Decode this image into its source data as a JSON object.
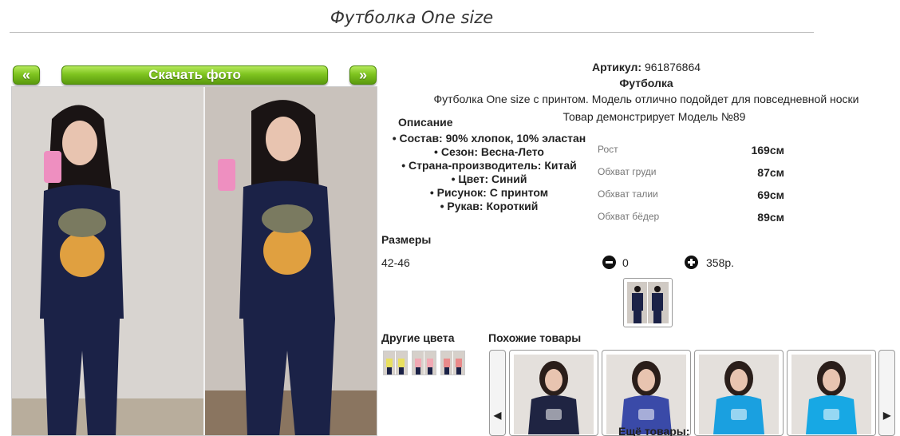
{
  "product": {
    "title": "Футболка One size",
    "article_label": "Артикул:",
    "article_value": "961876864",
    "type": "Футболка",
    "short_description": "Футболка One size с принтом. Модель отлично подойдет для повседневной носки",
    "model_note": "Товар демонстрирует Модель №89"
  },
  "gallery": {
    "prev_label": "«",
    "download_label": "Скачать фото",
    "next_label": "»"
  },
  "description": {
    "heading": "Описание",
    "items": [
      "Состав: 90% хлопок, 10% эластан",
      "Сезон: Весна-Лето",
      "Страна-производитель: Китай",
      "Цвет: Синий",
      "Рисунок: С принтом",
      "Рукав: Короткий"
    ]
  },
  "measurements": [
    {
      "label": "Рост",
      "value": "169см"
    },
    {
      "label": "Обхват груди",
      "value": "87см"
    },
    {
      "label": "Обхват талии",
      "value": "69см"
    },
    {
      "label": "Обхват бёдер",
      "value": "89см"
    }
  ],
  "sizes": {
    "heading": "Размеры",
    "size": "42-46",
    "quantity": "0",
    "price": "358р."
  },
  "other_colors": {
    "heading": "Другие цвета",
    "colors": [
      "#e9e060",
      "#f1a9b4",
      "#e98a8a"
    ]
  },
  "similar": {
    "heading": "Похожие товары",
    "more_label": "Ещё товары:",
    "left_arrow": "◀",
    "right_arrow": "▶",
    "items": [
      {
        "shirt_color": "#1f2442"
      },
      {
        "shirt_color": "#3a4aa8"
      },
      {
        "shirt_color": "#1aa0e0"
      },
      {
        "shirt_color": "#17a8e4"
      }
    ]
  },
  "colors": {
    "button_green": "#7fc420",
    "shirt_navy": "#1b2247"
  }
}
